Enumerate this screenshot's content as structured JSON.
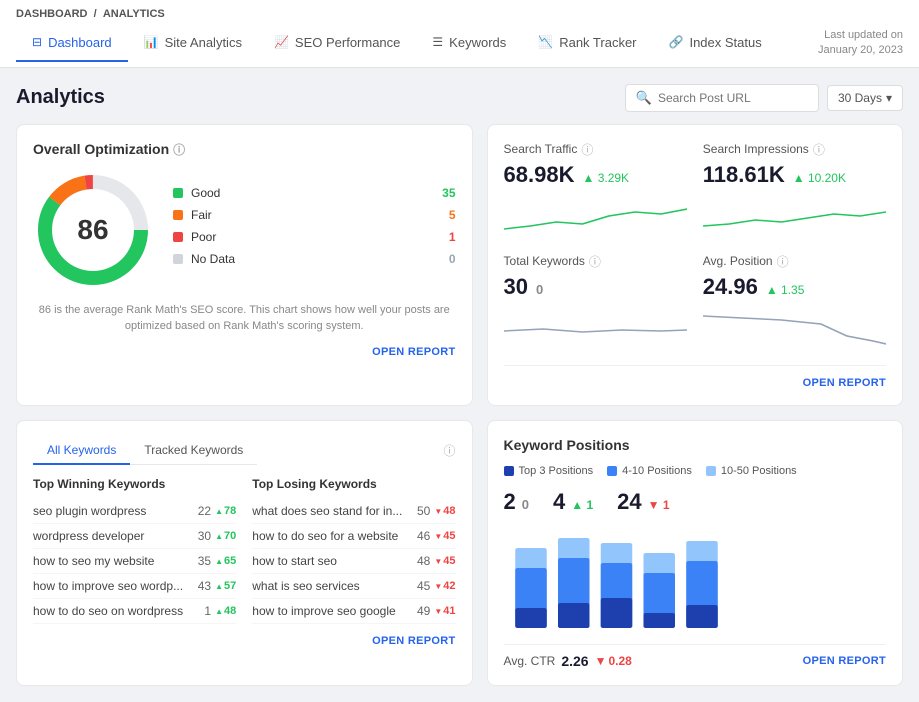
{
  "breadcrumb": {
    "root": "DASHBOARD",
    "separator": "/",
    "current": "ANALYTICS"
  },
  "tabs": [
    {
      "id": "dashboard",
      "label": "Dashboard",
      "active": true,
      "icon": "⊟"
    },
    {
      "id": "site-analytics",
      "label": "Site Analytics",
      "active": false,
      "icon": "📊"
    },
    {
      "id": "seo-performance",
      "label": "SEO Performance",
      "active": false,
      "icon": "📈"
    },
    {
      "id": "keywords",
      "label": "Keywords",
      "active": false,
      "icon": "☰"
    },
    {
      "id": "rank-tracker",
      "label": "Rank Tracker",
      "active": false,
      "icon": "📉"
    },
    {
      "id": "index-status",
      "label": "Index Status",
      "active": false,
      "icon": "🔗"
    }
  ],
  "last_updated": {
    "label": "Last updated on",
    "date": "January 20, 2023"
  },
  "page": {
    "title": "Analytics",
    "search_placeholder": "Search Post URL",
    "days_label": "30 Days"
  },
  "overall_optimization": {
    "title": "Overall Optimization",
    "score": "86",
    "score_desc": "86 is the average Rank Math's SEO score. This chart shows how well your posts are optimized based on Rank Math's scoring system.",
    "open_report": "OPEN REPORT",
    "legend": [
      {
        "label": "Good",
        "count": "35",
        "color": "#22c55e",
        "type": "green"
      },
      {
        "label": "Fair",
        "count": "5",
        "color": "#f97316",
        "type": "orange"
      },
      {
        "label": "Poor",
        "count": "1",
        "color": "#ef4444",
        "type": "red"
      },
      {
        "label": "No Data",
        "count": "0",
        "color": "#d1d5db",
        "type": "gray"
      }
    ]
  },
  "search_traffic": {
    "metrics": [
      {
        "id": "search-traffic",
        "label": "Search Traffic",
        "value": "68.98K",
        "change": "3.29K",
        "direction": "up"
      },
      {
        "id": "search-impressions",
        "label": "Search Impressions",
        "value": "118.61K",
        "change": "10.20K",
        "direction": "up"
      },
      {
        "id": "total-keywords",
        "label": "Total Keywords",
        "value": "30",
        "change": "0",
        "direction": "neutral"
      },
      {
        "id": "avg-position",
        "label": "Avg. Position",
        "value": "24.96",
        "change": "1.35",
        "direction": "up"
      }
    ],
    "open_report": "OPEN REPORT"
  },
  "keywords": {
    "tabs": [
      "All Keywords",
      "Tracked Keywords"
    ],
    "active_tab": "All Keywords",
    "winning_header": "Top Winning Keywords",
    "losing_header": "Top Losing Keywords",
    "winning": [
      {
        "name": "seo plugin wordpress",
        "pos": "22",
        "change": "78",
        "dir": "up"
      },
      {
        "name": "wordpress developer",
        "pos": "30",
        "change": "70",
        "dir": "up"
      },
      {
        "name": "how to seo my website",
        "pos": "35",
        "change": "65",
        "dir": "up"
      },
      {
        "name": "how to improve seo wordp...",
        "pos": "43",
        "change": "57",
        "dir": "up"
      },
      {
        "name": "how to do seo on wordpress",
        "pos": "1",
        "change": "48",
        "dir": "up"
      }
    ],
    "losing": [
      {
        "name": "what does seo stand for in...",
        "pos": "50",
        "change": "48",
        "dir": "down"
      },
      {
        "name": "how to do seo for a website",
        "pos": "46",
        "change": "45",
        "dir": "down"
      },
      {
        "name": "how to start seo",
        "pos": "48",
        "change": "45",
        "dir": "down"
      },
      {
        "name": "what is seo services",
        "pos": "45",
        "change": "42",
        "dir": "down"
      },
      {
        "name": "how to improve seo google",
        "pos": "49",
        "change": "41",
        "dir": "down"
      }
    ],
    "open_report": "OPEN REPORT"
  },
  "keyword_positions": {
    "title": "Keyword Positions",
    "legend": [
      {
        "label": "Top 3 Positions",
        "color": "#1e40af"
      },
      {
        "label": "4-10 Positions",
        "color": "#3b82f6"
      },
      {
        "label": "10-50 Positions",
        "color": "#93c5fd"
      }
    ],
    "stats": [
      {
        "label": "",
        "value": "2",
        "change": "0",
        "dir": "neutral"
      },
      {
        "label": "",
        "value": "4",
        "change": "1",
        "dir": "up"
      },
      {
        "label": "",
        "value": "24",
        "change": "1",
        "dir": "down"
      }
    ],
    "bars": [
      {
        "top3": 15,
        "mid": 40,
        "low": 85
      },
      {
        "top3": 10,
        "mid": 55,
        "low": 90
      },
      {
        "top3": 20,
        "mid": 45,
        "low": 80
      },
      {
        "top3": 8,
        "mid": 35,
        "low": 75
      },
      {
        "top3": 12,
        "mid": 50,
        "low": 85
      }
    ],
    "ctr_label": "Avg. CTR",
    "ctr_value": "2.26",
    "ctr_change": "0.28",
    "ctr_dir": "down",
    "open_report": "OPEN REPORT"
  }
}
